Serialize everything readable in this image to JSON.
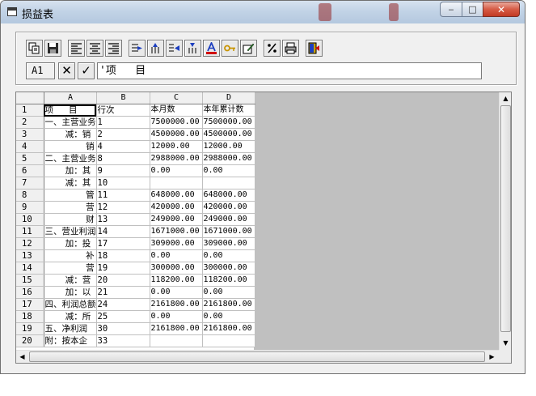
{
  "window": {
    "title": "损益表",
    "buttons": {
      "minimize": "‒",
      "maximize": "□",
      "close": "✕"
    }
  },
  "toolbar": {
    "icons": [
      "copy-icon",
      "save-icon",
      "align-left-icon",
      "align-center-icon",
      "align-right-icon",
      "insert-column-icon",
      "insert-row-icon",
      "delete-column-icon",
      "delete-row-icon",
      "font-color-icon",
      "key-icon",
      "edit-icon",
      "percent-icon",
      "print-icon",
      "exit-icon"
    ]
  },
  "formula_bar": {
    "cell_ref": "A1",
    "cancel_label": "✕",
    "confirm_label": "✓",
    "value": "'项   目"
  },
  "sheet": {
    "columns": [
      "A",
      "B",
      "C",
      "D"
    ],
    "rows": [
      {
        "n": "1",
        "a": "项   目",
        "b": "行次",
        "c": "本月数",
        "d": "本年累计数"
      },
      {
        "n": "2",
        "a": "一、主营业务",
        "b": "1",
        "c": "7500000.00",
        "d": "7500000.00"
      },
      {
        "n": "3",
        "a": "    减：销",
        "b": "2",
        "c": "4500000.00",
        "d": "4500000.00"
      },
      {
        "n": "4",
        "a": "        销",
        "b": "4",
        "c": "12000.00",
        "d": "12000.00"
      },
      {
        "n": "5",
        "a": "二、主营业务",
        "b": "8",
        "c": "2988000.00",
        "d": "2988000.00"
      },
      {
        "n": "6",
        "a": "    加：其",
        "b": "9",
        "c": "0.00",
        "d": "0.00"
      },
      {
        "n": "7",
        "a": "    减：其",
        "b": "10",
        "c": "",
        "d": ""
      },
      {
        "n": "8",
        "a": "        管",
        "b": "11",
        "c": "648000.00",
        "d": "648000.00"
      },
      {
        "n": "9",
        "a": "        营",
        "b": "12",
        "c": "420000.00",
        "d": "420000.00"
      },
      {
        "n": "10",
        "a": "        财",
        "b": "13",
        "c": "249000.00",
        "d": "249000.00"
      },
      {
        "n": "11",
        "a": "三、营业利润",
        "b": "14",
        "c": "1671000.00",
        "d": "1671000.00"
      },
      {
        "n": "12",
        "a": "    加：投",
        "b": "17",
        "c": "309000.00",
        "d": "309000.00"
      },
      {
        "n": "13",
        "a": "        补",
        "b": "18",
        "c": "0.00",
        "d": "0.00"
      },
      {
        "n": "14",
        "a": "        营",
        "b": "19",
        "c": "300000.00",
        "d": "300000.00"
      },
      {
        "n": "15",
        "a": "    减：营",
        "b": "20",
        "c": "118200.00",
        "d": "118200.00"
      },
      {
        "n": "16",
        "a": "    加：以",
        "b": "21",
        "c": "0.00",
        "d": "0.00"
      },
      {
        "n": "17",
        "a": "四、利润总额",
        "b": "24",
        "c": "2161800.00",
        "d": "2161800.00"
      },
      {
        "n": "18",
        "a": "    减：所",
        "b": "25",
        "c": "0.00",
        "d": "0.00"
      },
      {
        "n": "19",
        "a": "五、净利润",
        "b": "30",
        "c": "2161800.00",
        "d": "2161800.00"
      },
      {
        "n": "20",
        "a": "附：按本企",
        "b": "33",
        "c": "",
        "d": ""
      }
    ]
  },
  "scrollbars": {
    "up": "▲",
    "down": "▼",
    "left": "◀",
    "right": "▶"
  }
}
